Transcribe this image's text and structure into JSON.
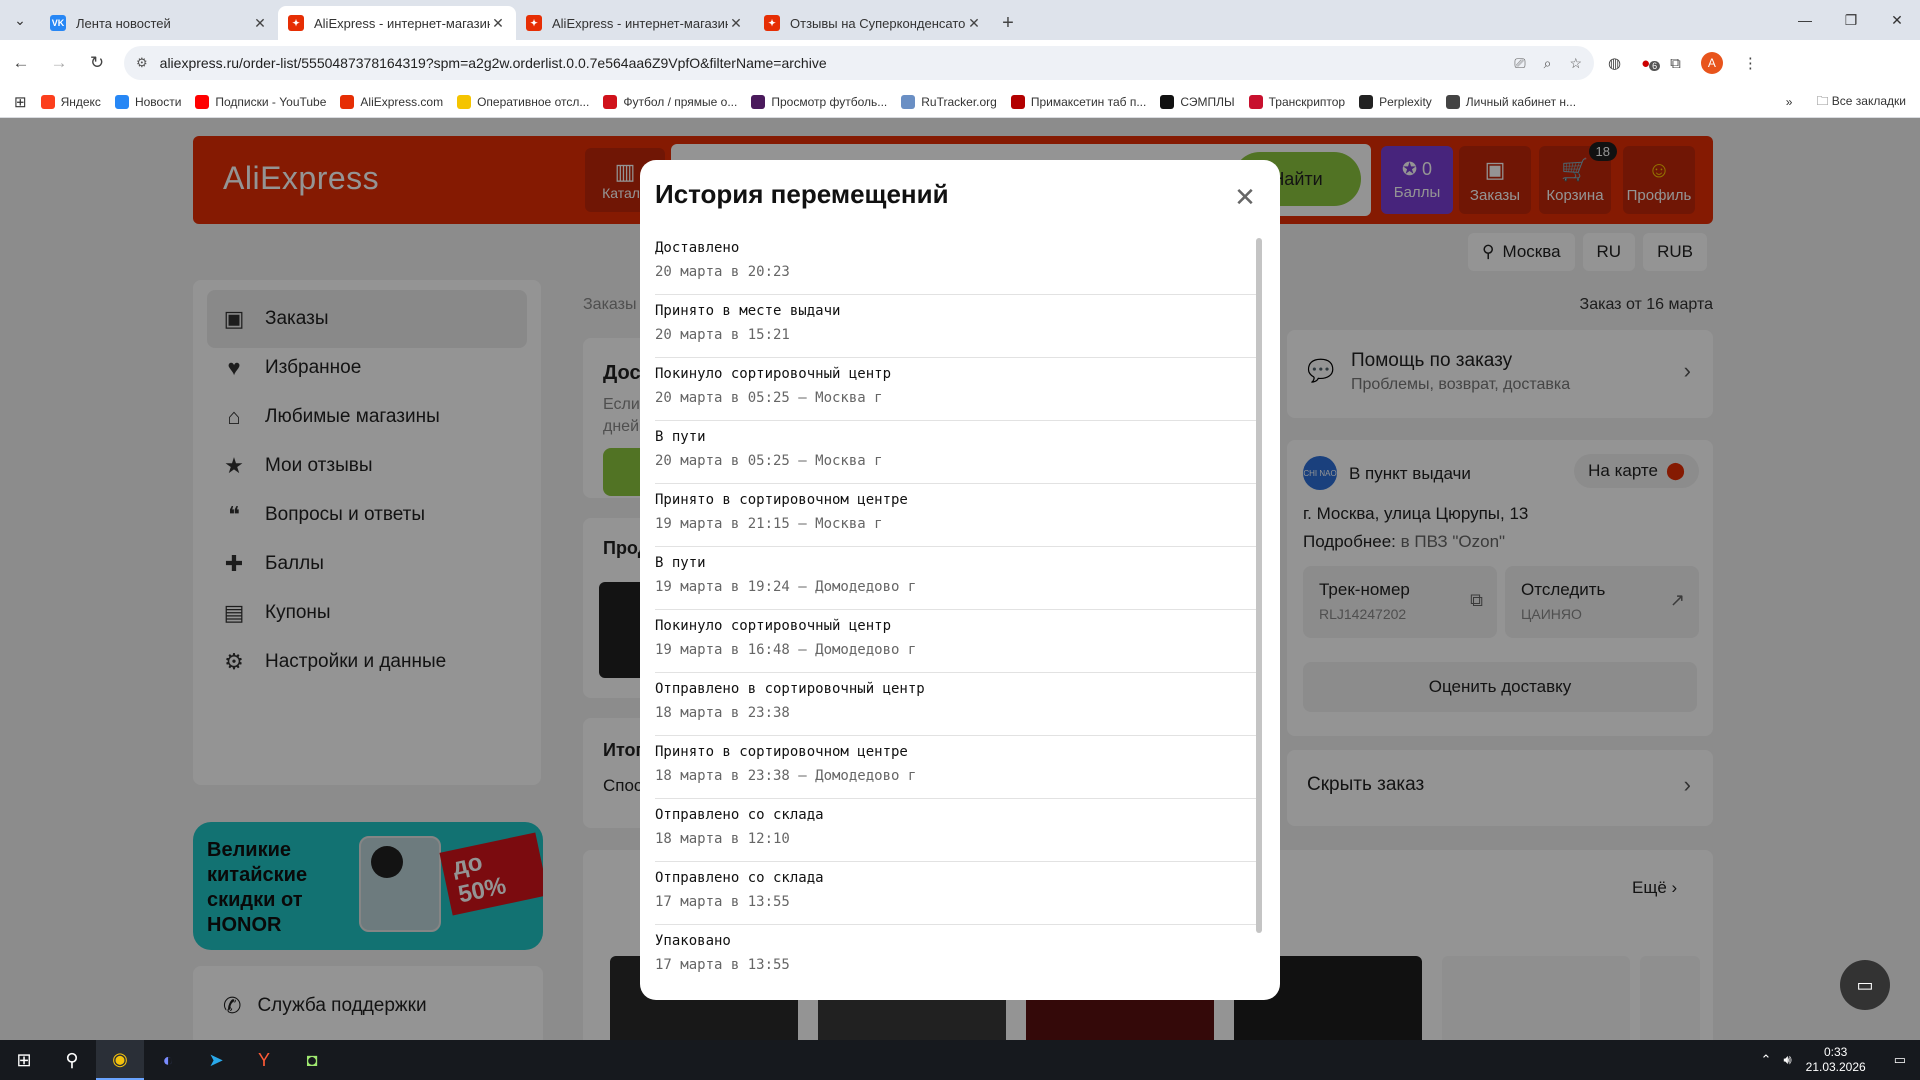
{
  "browser": {
    "tabs": [
      {
        "title": "Лента новостей",
        "favicon_color": "#2787f5",
        "favicon_text": "VK",
        "active": false
      },
      {
        "title": "AliExpress - интернет-магазин",
        "favicon_color": "#e62e04",
        "favicon_text": "✦",
        "active": true
      },
      {
        "title": "AliExpress - интернет-магазин",
        "favicon_color": "#e62e04",
        "favicon_text": "✦",
        "active": false
      },
      {
        "title": "Отзывы на Суперконденсатор",
        "favicon_color": "#e62e04",
        "favicon_text": "✦",
        "active": false
      }
    ],
    "url": "aliexpress.ru/order-list/5550487378164319?spm=a2g2w.orderlist.0.0.7e564aa6Z9VpfO&filterName=archive",
    "profile_initial": "A",
    "extension_badge": "6",
    "bookmarks": [
      {
        "label": "Яндекс",
        "color": "#fc3f1d"
      },
      {
        "label": "Новости",
        "color": "#2787f5"
      },
      {
        "label": "Подписки - YouTube",
        "color": "#ff0000"
      },
      {
        "label": "AliExpress.com",
        "color": "#e62e04"
      },
      {
        "label": "Оперативное отсл...",
        "color": "#f5c400"
      },
      {
        "label": "Футбол / прямые о...",
        "color": "#d0121b"
      },
      {
        "label": "Просмотр футболь...",
        "color": "#4a1a5c"
      },
      {
        "label": "RuTracker.org",
        "color": "#6a8fc4"
      },
      {
        "label": "Примаксетин таб п...",
        "color": "#b30000"
      },
      {
        "label": "СЭМПЛЫ",
        "color": "#111111"
      },
      {
        "label": "Транскриптор",
        "color": "#c8102e"
      },
      {
        "label": "Perplexity",
        "color": "#222222"
      },
      {
        "label": "Личный кабинет н...",
        "color": "#444444"
      }
    ],
    "all_bookmarks": "Все закладки"
  },
  "header": {
    "logo": "AliExpress",
    "catalog": "Катало",
    "search_button": "Найти",
    "points_count": "0",
    "points_label": "Баллы",
    "orders_label": "Заказы",
    "cart_label": "Корзина",
    "cart_badge": "18",
    "profile_label": "Профиль",
    "brand_color": "#e62e04"
  },
  "locale": {
    "city": "Москва",
    "lang": "RU",
    "currency": "RUB"
  },
  "sidebar": {
    "items": [
      {
        "label": "Заказы",
        "icon": "box-icon",
        "glyph": "▣"
      },
      {
        "label": "Избранное",
        "icon": "heart-icon",
        "glyph": "♥"
      },
      {
        "label": "Любимые магазины",
        "icon": "store-icon",
        "glyph": "⌂"
      },
      {
        "label": "Мои отзывы",
        "icon": "star-icon",
        "glyph": "★"
      },
      {
        "label": "Вопросы и ответы",
        "icon": "chat-icon",
        "glyph": "❝"
      },
      {
        "label": "Баллы",
        "icon": "points-icon",
        "glyph": "✚"
      },
      {
        "label": "Купоны",
        "icon": "coupon-icon",
        "glyph": "▤"
      },
      {
        "label": "Настройки и данные",
        "icon": "gear-icon",
        "glyph": "⚙"
      }
    ],
    "promo": {
      "text": "Великие китайские скидки от HONOR",
      "sale": "до 50%"
    },
    "support": "Служба поддержки"
  },
  "main": {
    "breadcrumb": "Заказы",
    "order_date": "Заказ от 16 марта",
    "card1_title": "Дос",
    "card1_text": "Если",
    "card1_text2": "дней",
    "card2_title": "Прод",
    "card3_title": "Итог",
    "card3_text": "Спос",
    "more_link": "Ещё"
  },
  "right": {
    "help_title": "Помощь по заказу",
    "help_sub": "Проблемы, возврат, доставка",
    "pickup_logo": "CHI NAO",
    "pickup_title": "В пункт выдачи",
    "on_map": "На карте",
    "address": "г. Москва, улица Цюрупы, 13",
    "more_prefix": "Подробнее:",
    "more_link": "в ПВЗ \"Ozon\"",
    "track_label": "Трек-номер",
    "track_value": "RLJ14247202",
    "trace_label": "Отследить",
    "trace_value": "ЦАИНЯО",
    "rate_delivery": "Оценить доставку",
    "hide_order": "Скрыть заказ"
  },
  "modal": {
    "title": "История перемещений",
    "events": [
      {
        "status": "Доставлено",
        "when": "20 марта в 20:23"
      },
      {
        "status": "Принято в месте выдачи",
        "when": "20 марта в 15:21"
      },
      {
        "status": "Покинуло сортировочный центр",
        "when": "20 марта в 05:25 — Москва г"
      },
      {
        "status": "В пути",
        "when": "20 марта в 05:25 — Москва г"
      },
      {
        "status": "Принято в сортировочном центре",
        "when": "19 марта в 21:15 — Москва г"
      },
      {
        "status": "В пути",
        "when": "19 марта в 19:24 — Домодедово г"
      },
      {
        "status": "Покинуло сортировочный центр",
        "when": "19 марта в 16:48 — Домодедово г"
      },
      {
        "status": "Отправлено в сортировочный центр",
        "when": "18 марта в 23:38"
      },
      {
        "status": "Принято в сортировочном центре",
        "when": "18 марта в 23:38 — Домодедово г"
      },
      {
        "status": "Отправлено со склада",
        "when": "18 марта в 12:10"
      },
      {
        "status": "Отправлено со склада",
        "when": "17 марта в 13:55"
      },
      {
        "status": "Упаковано",
        "when": "17 марта в 13:55"
      }
    ]
  },
  "taskbar": {
    "time": "0:33",
    "date": "21.03.2026"
  }
}
